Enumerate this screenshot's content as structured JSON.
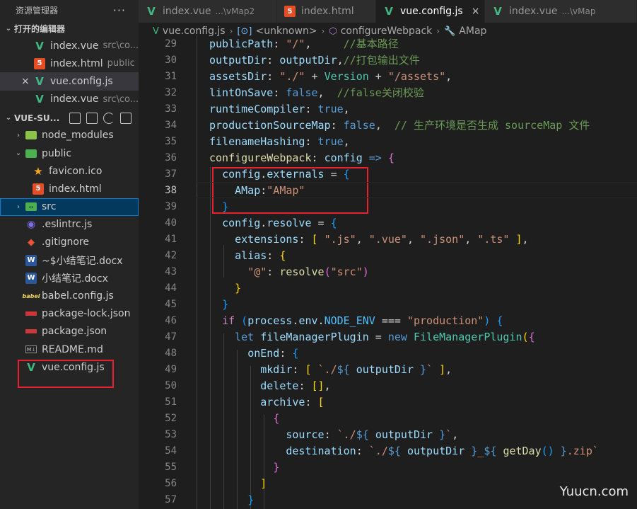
{
  "sidebar": {
    "title": "资源管理器",
    "more": "···",
    "open_editors": {
      "label": "打开的编辑器",
      "items": [
        {
          "name": "index.vue",
          "desc": "src\\co...",
          "icon": "vue-icon"
        },
        {
          "name": "index.html",
          "desc": "public",
          "icon": "html-icon"
        },
        {
          "name": "vue.config.js",
          "desc": "",
          "icon": "vue-icon",
          "close": "×"
        },
        {
          "name": "index.vue",
          "desc": "src\\co...",
          "icon": "vue-icon"
        }
      ]
    },
    "project": {
      "label": "VUE-SU...",
      "tree": [
        {
          "name": "node_modules",
          "icon": "folder-node-icon",
          "chev": "›"
        },
        {
          "name": "public",
          "icon": "folder-public-icon",
          "chev": "⌄"
        },
        {
          "name": "favicon.ico",
          "icon": "star-icon"
        },
        {
          "name": "index.html",
          "icon": "html-icon"
        },
        {
          "name": "src",
          "icon": "folder-src-icon",
          "chev": "›"
        },
        {
          "name": ".eslintrc.js",
          "icon": "eslint-icon"
        },
        {
          "name": ".gitignore",
          "icon": "git-icon"
        },
        {
          "name": "~$小结笔记.docx",
          "icon": "word-icon"
        },
        {
          "name": "小结笔记.docx",
          "icon": "word-icon"
        },
        {
          "name": "babel.config.js",
          "icon": "babel-icon"
        },
        {
          "name": "package-lock.json",
          "icon": "npm-icon"
        },
        {
          "name": "package.json",
          "icon": "npm-icon"
        },
        {
          "name": "README.md",
          "icon": "markdown-icon"
        },
        {
          "name": "vue.config.js",
          "icon": "vue-icon"
        }
      ]
    }
  },
  "tabs": [
    {
      "name": "index.vue",
      "desc": "...\\vMap2",
      "icon": "vue-icon"
    },
    {
      "name": "index.html",
      "desc": "",
      "icon": "html-icon"
    },
    {
      "name": "vue.config.js",
      "desc": "",
      "icon": "vue-icon",
      "close": "×"
    },
    {
      "name": "index.vue",
      "desc": "...\\vMap",
      "icon": "vue-icon"
    }
  ],
  "breadcrumb": [
    "vue.config.js",
    "<unknown>",
    "configureWebpack",
    "AMap"
  ],
  "editor": {
    "current_line": 38,
    "lines": [
      {
        "n": "29",
        "html": "<span class='t-prop'>publicPath</span>: <span class='t-str'>\"/\"</span>,     <span class='t-cmt'>//基本路径</span>"
      },
      {
        "n": "30",
        "html": "<span class='t-prop'>outputDir</span>: <span class='t-prop'>outputDir</span>,<span class='t-cmt'>//打包输出文件</span>"
      },
      {
        "n": "31",
        "html": "<span class='t-prop'>assetsDir</span>: <span class='t-str'>\"./\"</span> + <span class='t-cls'>Version</span> + <span class='t-str'>\"/assets\"</span>,"
      },
      {
        "n": "32",
        "html": "<span class='t-prop'>lintOnSave</span>: <span class='t-kw'>false</span>,  <span class='t-cmt'>//false关闭校验</span>"
      },
      {
        "n": "33",
        "html": "<span class='t-prop'>runtimeCompiler</span>: <span class='t-kw'>true</span>,"
      },
      {
        "n": "34",
        "html": "<span class='t-prop'>productionSourceMap</span>: <span class='t-kw'>false</span>,  <span class='t-cmt'>// 生产环境是否生成 sourceMap 文件</span>"
      },
      {
        "n": "35",
        "html": "<span class='t-prop'>filenameHashing</span>: <span class='t-kw'>true</span>,"
      },
      {
        "n": "36",
        "html": "<span class='t-fn'>configureWebpack</span>: <span class='t-prop'>config</span> <span class='t-kw'>=&gt;</span> <span class='b2'>{</span>"
      },
      {
        "n": "37",
        "html": "  <span class='t-prop'>config</span>.<span class='t-prop'>externals</span> = <span class='b3'>{</span>"
      },
      {
        "n": "38",
        "html": "    <span class='t-prop'>AMap</span>:<span class='t-str'>\"AMap\"</span>"
      },
      {
        "n": "39",
        "html": "  <span class='b3'>}</span>"
      },
      {
        "n": "40",
        "html": "  <span class='t-prop'>config</span>.<span class='t-prop'>resolve</span> = <span class='b3'>{</span>"
      },
      {
        "n": "41",
        "html": "    <span class='t-prop'>extensions</span>: <span class='b1'>[</span> <span class='t-str'>\".js\"</span>, <span class='t-str'>\".vue\"</span>, <span class='t-str'>\".json\"</span>, <span class='t-str'>\".ts\"</span> <span class='b1'>]</span>,"
      },
      {
        "n": "42",
        "html": "    <span class='t-prop'>alias</span>: <span class='b1'>{</span>"
      },
      {
        "n": "43",
        "html": "      <span class='t-str'>\"@\"</span>: <span class='t-fn'>resolve</span><span class='b2'>(</span><span class='t-str'>\"src\"</span><span class='b2'>)</span>"
      },
      {
        "n": "44",
        "html": "    <span class='b1'>}</span>"
      },
      {
        "n": "45",
        "html": "  <span class='b3'>}</span>"
      },
      {
        "n": "46",
        "html": "  <span class='t-ctl'>if</span> <span class='b3'>(</span><span class='t-prop'>process</span>.<span class='t-prop'>env</span>.<span class='t-const'>NODE_ENV</span> === <span class='t-str'>\"production\"</span><span class='b3'>)</span> <span class='b3'>{</span>"
      },
      {
        "n": "47",
        "html": "    <span class='t-kw'>let</span> <span class='t-prop'>fileManagerPlugin</span> = <span class='t-kw'>new</span> <span class='t-cls'>FileManagerPlugin</span><span class='b1'>(</span><span class='b2'>{</span>"
      },
      {
        "n": "48",
        "html": "      <span class='t-prop'>onEnd</span>: <span class='b3'>{</span>"
      },
      {
        "n": "49",
        "html": "        <span class='t-prop'>mkdir</span>: <span class='b1'>[</span> <span class='t-str'>`./</span><span class='t-kw'>${</span> <span class='t-prop'>outputDir</span> <span class='t-kw'>}</span><span class='t-str'>`</span> <span class='b1'>]</span>,"
      },
      {
        "n": "50",
        "html": "        <span class='t-prop'>delete</span>: <span class='b1'>[]</span>,"
      },
      {
        "n": "51",
        "html": "        <span class='t-prop'>archive</span>: <span class='b1'>[</span>"
      },
      {
        "n": "52",
        "html": "          <span class='b2'>{</span>"
      },
      {
        "n": "53",
        "html": "            <span class='t-prop'>source</span>: <span class='t-str'>`./</span><span class='t-kw'>${</span> <span class='t-prop'>outputDir</span> <span class='t-kw'>}</span><span class='t-str'>`</span>,"
      },
      {
        "n": "54",
        "html": "            <span class='t-prop'>destination</span>: <span class='t-str'>`./</span><span class='t-kw'>${</span> <span class='t-prop'>outputDir</span> <span class='t-kw'>}</span><span class='t-str'>_</span><span class='t-kw'>${</span> <span class='t-fn'>getDay</span><span class='b3'>()</span> <span class='t-kw'>}</span><span class='t-str'>.zip`</span>"
      },
      {
        "n": "55",
        "html": "          <span class='b2'>}</span>"
      },
      {
        "n": "56",
        "html": "        <span class='b1'>]</span>"
      },
      {
        "n": "57",
        "html": "      <span class='b3'>}</span>"
      }
    ]
  },
  "watermark": "Yuucn.com",
  "colors": {
    "highlight_box": "#e8212c",
    "accent": "#007fd4"
  }
}
